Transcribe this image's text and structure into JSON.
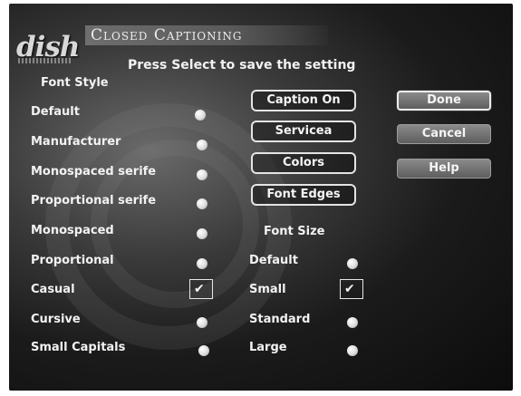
{
  "header": {
    "logo_text": "dish",
    "title": "Closed Captioning",
    "instruction": "Press Select to save the setting"
  },
  "font_style": {
    "heading": "Font Style",
    "options": [
      {
        "label": "Default",
        "selected": false
      },
      {
        "label": "Manufacturer",
        "selected": false
      },
      {
        "label": "Monospaced serife",
        "selected": false
      },
      {
        "label": "Proportional serife",
        "selected": false
      },
      {
        "label": "Monospaced",
        "selected": false
      },
      {
        "label": "Proportional",
        "selected": false
      },
      {
        "label": "Casual",
        "selected": true
      },
      {
        "label": "Cursive",
        "selected": false
      },
      {
        "label": "Small Capitals",
        "selected": false
      }
    ]
  },
  "middle_buttons": [
    {
      "label": "Caption On"
    },
    {
      "label": "Servicea"
    },
    {
      "label": "Colors"
    },
    {
      "label": "Font Edges"
    }
  ],
  "font_size": {
    "heading": "Font Size",
    "options": [
      {
        "label": "Default",
        "selected": false
      },
      {
        "label": "Small",
        "selected": true
      },
      {
        "label": "Standard",
        "selected": false
      },
      {
        "label": "Large",
        "selected": false
      }
    ]
  },
  "right_buttons": [
    {
      "label": "Done",
      "focused": true
    },
    {
      "label": "Cancel",
      "focused": false
    },
    {
      "label": "Help",
      "focused": false
    }
  ],
  "colors": {
    "text": "#f2f2f2",
    "background": "#1b1b1b",
    "button_fill": "#6e6e6e"
  },
  "icons": {
    "selected_marker": "check-icon",
    "unselected_marker": "radio-dot-icon"
  }
}
